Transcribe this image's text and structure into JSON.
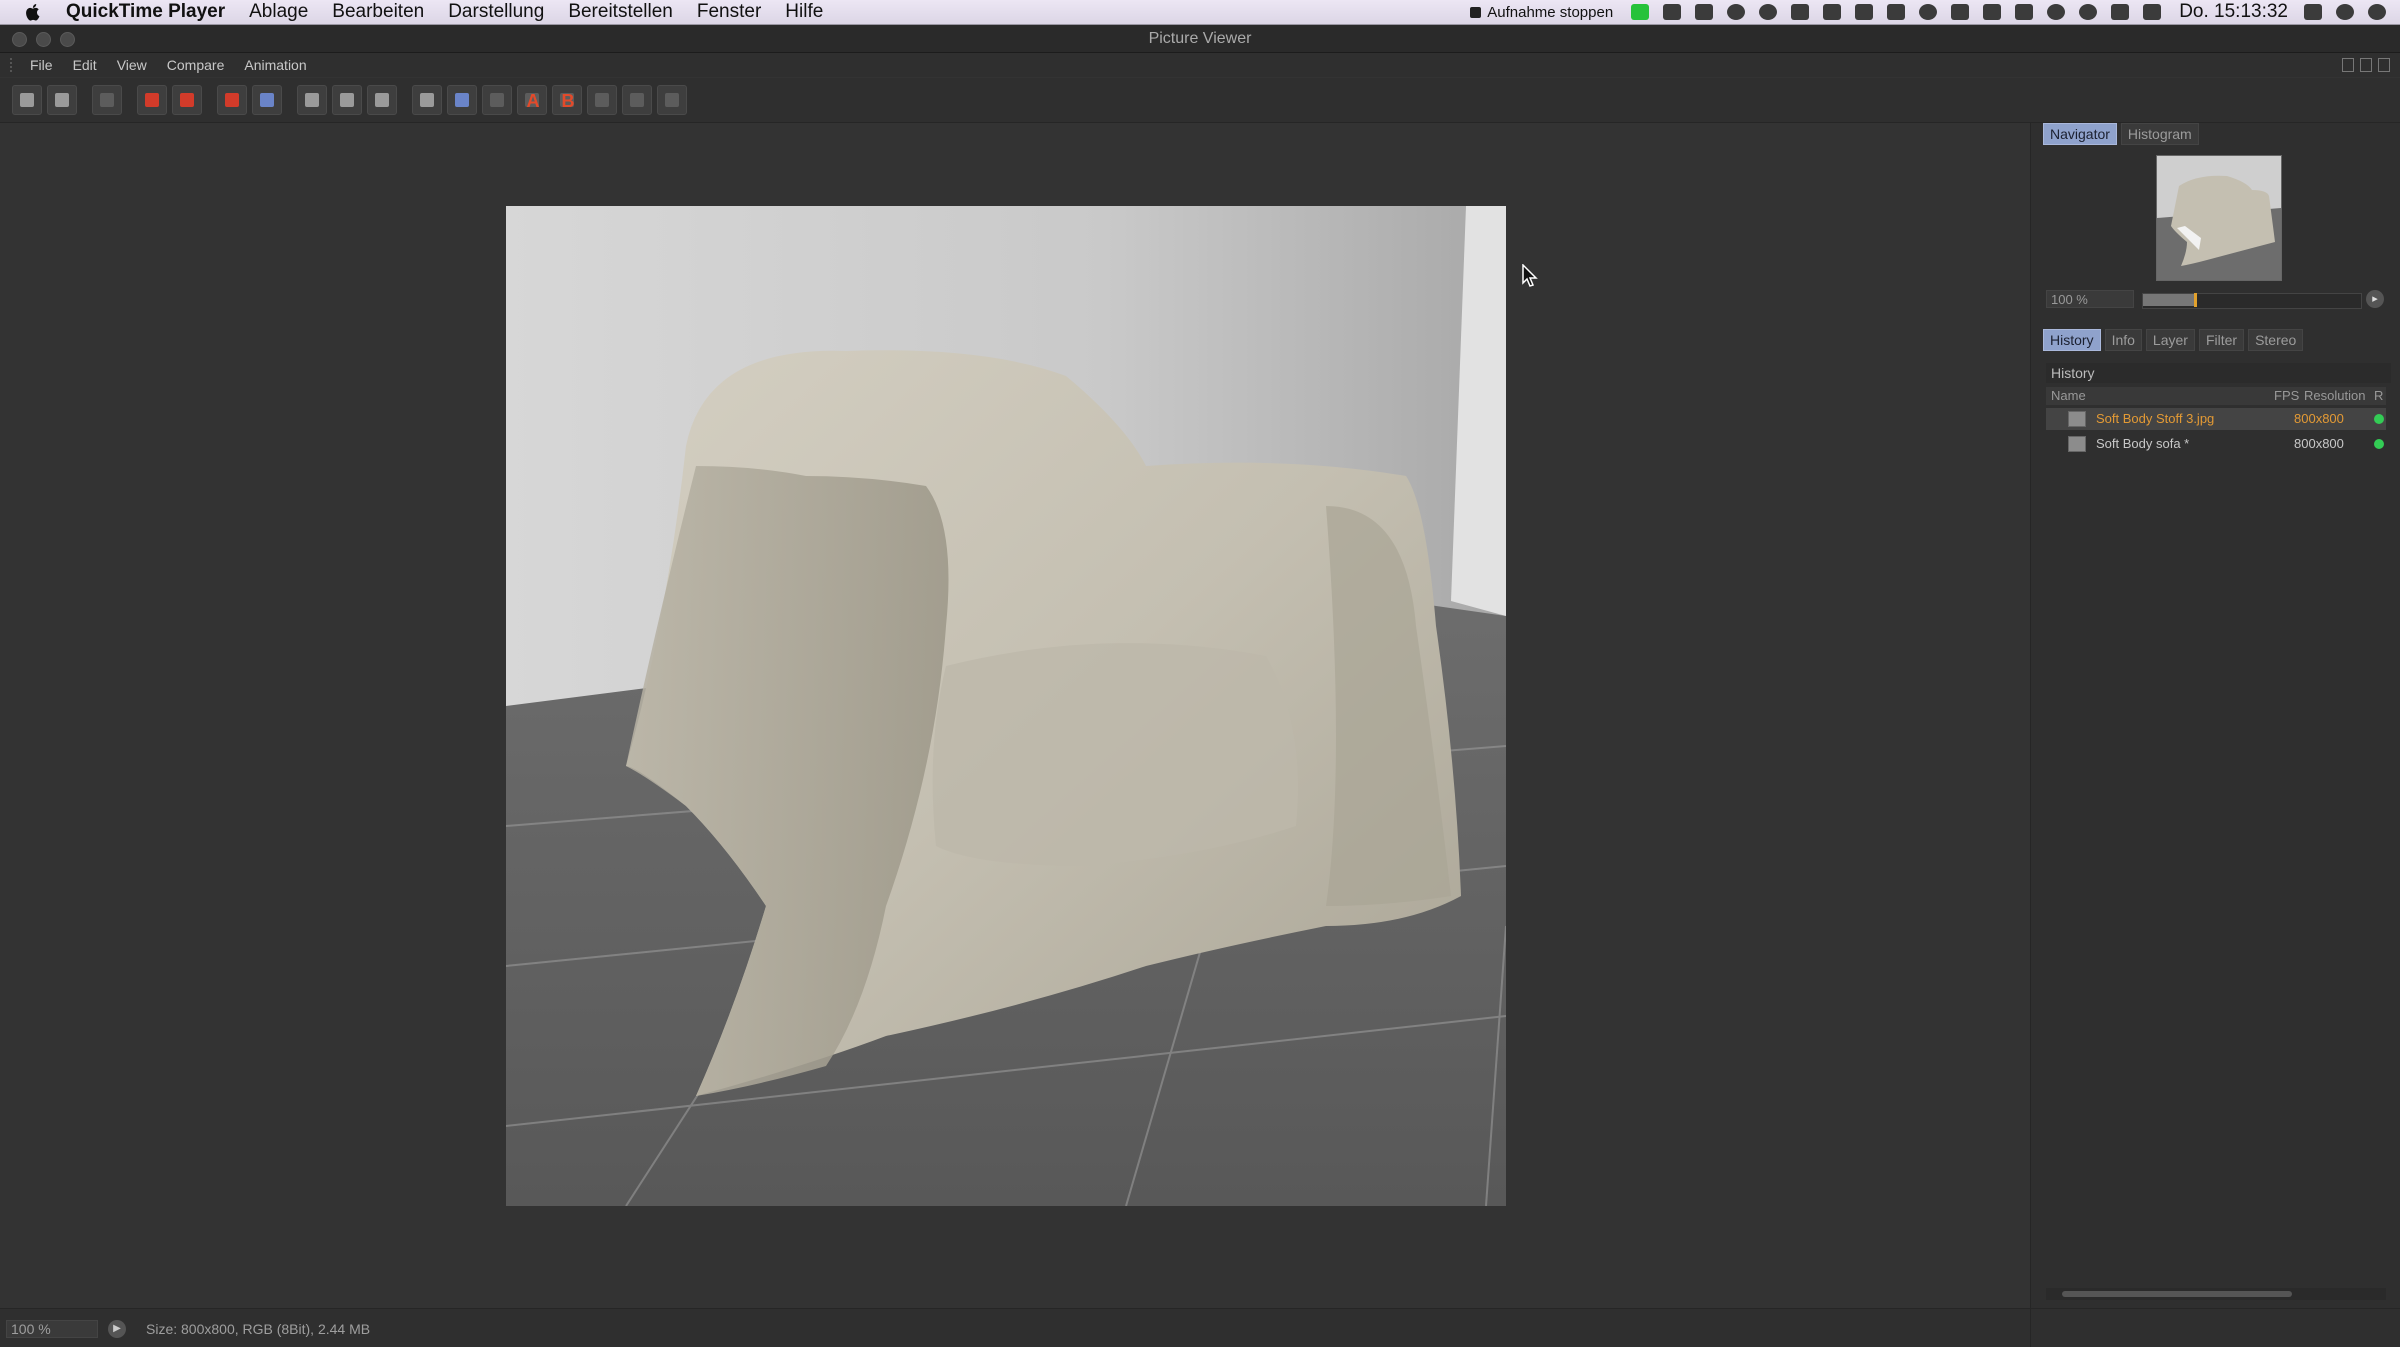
{
  "menubar": {
    "app_name": "QuickTime Player",
    "items": [
      "Ablage",
      "Bearbeiten",
      "Darstellung",
      "Bereitstellen",
      "Fenster",
      "Hilfe"
    ],
    "recording_label": "Aufnahme stoppen",
    "clock": "Do. 15:13:32"
  },
  "window": {
    "title": "Picture Viewer"
  },
  "app_menu": {
    "items": [
      "File",
      "Edit",
      "View",
      "Compare",
      "Animation"
    ]
  },
  "toolbar": {
    "compare_a_label": "A",
    "compare_b_label": "B"
  },
  "navigator": {
    "tabs": [
      "Navigator",
      "Histogram"
    ],
    "active_tab": "Navigator",
    "zoom_value": "100 %",
    "zoom_fraction": 0.24
  },
  "panel_tabs": {
    "tabs": [
      "History",
      "Info",
      "Layer",
      "Filter",
      "Stereo"
    ],
    "active_tab": "History"
  },
  "history": {
    "header": "History",
    "columns": [
      "Name",
      "FPS",
      "Resolution",
      "R"
    ],
    "rows": [
      {
        "name": "Soft Body Stoff 3.jpg",
        "resolution": "800x800",
        "selected": true
      },
      {
        "name": "Soft Body sofa *",
        "resolution": "800x800",
        "selected": false
      }
    ]
  },
  "statusbar": {
    "zoom": "100 %",
    "info": "Size: 800x800, RGB (8Bit), 2.44 MB"
  },
  "colors": {
    "accent_orange": "#e39a35",
    "status_green": "#33cc55",
    "active_tab": "#8fa2cc"
  }
}
